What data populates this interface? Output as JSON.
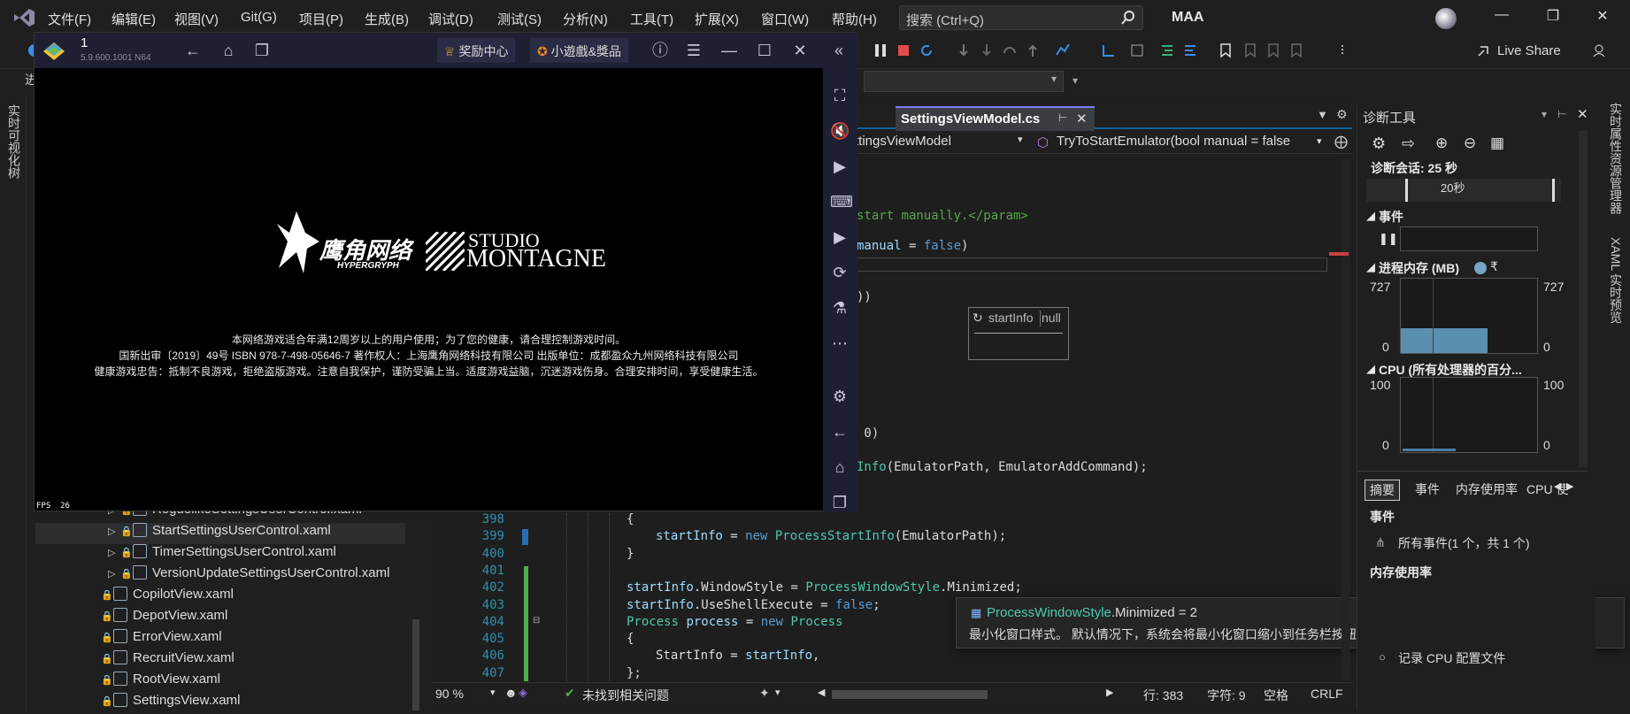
{
  "menubar": {
    "items": [
      "文件(F)",
      "编辑(E)",
      "视图(V)",
      "Git(G)",
      "项目(P)",
      "生成(B)",
      "调试(D)",
      "测试(S)",
      "分析(N)",
      "工具(T)",
      "扩展(X)",
      "窗口(W)",
      "帮助(H)"
    ],
    "search_placeholder": "搜索 (Ctrl+Q)",
    "app_title": "MAA"
  },
  "toolbar": {
    "live_share": "Live Share"
  },
  "left_panel": {
    "vertical_label": "实时可视化树",
    "partial_label": "进"
  },
  "right_strip": {
    "label1": "实时属性资源管理器",
    "label2": "XAML 实时预览"
  },
  "emulator": {
    "instance": "1",
    "version": "5.9.600.1001 N64",
    "reward_label": "奖励中心",
    "game_label": "小遊戲&獎品",
    "fps_label": "FPS  26",
    "logo_brand": "鹰角网络",
    "logo_brand_sub": "HYPERGRYPH",
    "logo_studio": "STUDIO",
    "logo_studio_name": "MONTAGNE",
    "notice_lines": [
      "本网络游戏适合年满12周岁以上的用户使用；为了您的健康，请合理控制游戏时间。",
      "国新出审〔2019〕49号 ISBN 978-7-498-05646-7 著作权人：上海鹰角网络科技有限公司 出版单位：成都盈众九州网络科技有限公司",
      "健康游戏忠告：抵制不良游戏，拒绝盗版游戏。注意自我保护，谨防受骗上当。适度游戏益脑，沉迷游戏伤身。合理安排时间，享受健康生活。"
    ]
  },
  "solution": {
    "items": [
      {
        "name": "RoguelikeSettingsUserControl.xaml",
        "indent": 1,
        "arrow": true
      },
      {
        "name": "StartSettingsUserControl.xaml",
        "indent": 1,
        "arrow": true,
        "selected": true
      },
      {
        "name": "TimerSettingsUserControl.xaml",
        "indent": 1,
        "arrow": true
      },
      {
        "name": "VersionUpdateSettingsUserControl.xaml",
        "indent": 1,
        "arrow": true
      },
      {
        "name": "CopilotView.xaml",
        "indent": 0,
        "arrow": false
      },
      {
        "name": "DepotView.xaml",
        "indent": 0,
        "arrow": false
      },
      {
        "name": "ErrorView.xaml",
        "indent": 0,
        "arrow": false
      },
      {
        "name": "RecruitView.xaml",
        "indent": 0,
        "arrow": false
      },
      {
        "name": "RootView.xaml",
        "indent": 0,
        "arrow": false
      },
      {
        "name": "SettingsView.xaml",
        "indent": 0,
        "arrow": false
      }
    ]
  },
  "editor": {
    "tab": "SettingsViewModel.cs",
    "nav_class": "ttingsViewModel",
    "nav_method": "TryToStartEmulator(bool manual = false",
    "frag_comment": "start manually.</param>",
    "frag_manual": "manual",
    "frag_eq": " = ",
    "frag_false": "false",
    "frag_paren": ")",
    "frag_dparen": "))",
    "frag_zero": " 0)",
    "frag_info": "Info",
    "frag_info_args": "(EmulatorPath, EmulatorAddCommand);",
    "lines": [
      {
        "n": "398",
        "t": "{"
      },
      {
        "n": "399",
        "t": "startInfo = new ProcessStartInfo(EmulatorPath);"
      },
      {
        "n": "400",
        "t": "}"
      },
      {
        "n": "401",
        "t": ""
      },
      {
        "n": "402",
        "t": "startInfo.WindowStyle = ProcessWindowStyle.Minimized;"
      },
      {
        "n": "403",
        "t": "startInfo.UseShellExecute = false;"
      },
      {
        "n": "404",
        "t": "Process process = new Process"
      },
      {
        "n": "405",
        "t": "{"
      },
      {
        "n": "406",
        "t": "StartInfo = startInfo,"
      },
      {
        "n": "407",
        "t": "};"
      }
    ],
    "datatip_name": "startInfo",
    "datatip_value": "null"
  },
  "tooltip": {
    "title_type": "ProcessWindowStyle",
    "title_rest": ".Minimized = 2",
    "desc": "最小化窗口样式。 默认情况下，系统会将最小化窗口缩小到任务栏按钮的大小并将最小化窗口移至任务栏上。"
  },
  "status": {
    "zoom": "90 %",
    "issues": "未找到相关问题",
    "line": "行: 383",
    "char": "字符: 9",
    "space": "空格",
    "eol": "CRLF"
  },
  "diagnostics": {
    "title": "诊断工具",
    "session": "诊断会话: 25 秒",
    "timeline_label": "20秒",
    "events_header": "事件",
    "memory_header": "进程内存 (MB)",
    "memory_legend": "₹",
    "memory_max": "727",
    "memory_min": "0",
    "cpu_header": "CPU (所有处理器的百分...",
    "cpu_max": "100",
    "cpu_min": "0",
    "tabs": [
      "摘要",
      "事件",
      "内存使用率",
      "CPU 使"
    ],
    "summary_events": "事件",
    "all_events": "所有事件(1 个，共 1 个)",
    "memory_usage": "内存使用率",
    "cpu_profile": "记录 CPU 配置文件"
  }
}
